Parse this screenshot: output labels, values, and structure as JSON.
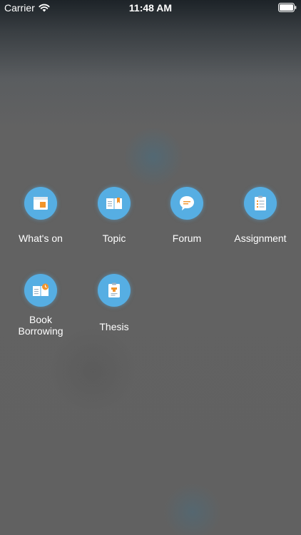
{
  "status_bar": {
    "carrier": "Carrier",
    "time": "11:48 AM"
  },
  "menu": {
    "items": [
      {
        "label": "What's on",
        "icon": "calendar-icon"
      },
      {
        "label": "Topic",
        "icon": "open-book-icon"
      },
      {
        "label": "Forum",
        "icon": "speech-bubble-icon"
      },
      {
        "label": "Assignment",
        "icon": "clipboard-list-icon"
      },
      {
        "label": "Book Borrowing",
        "icon": "book-clock-icon"
      },
      {
        "label": "Thesis",
        "icon": "clipboard-thesis-icon"
      }
    ]
  },
  "colors": {
    "icon_circle": "#56aee3",
    "icon_accent": "#f2952c",
    "backdrop": "#616161"
  }
}
